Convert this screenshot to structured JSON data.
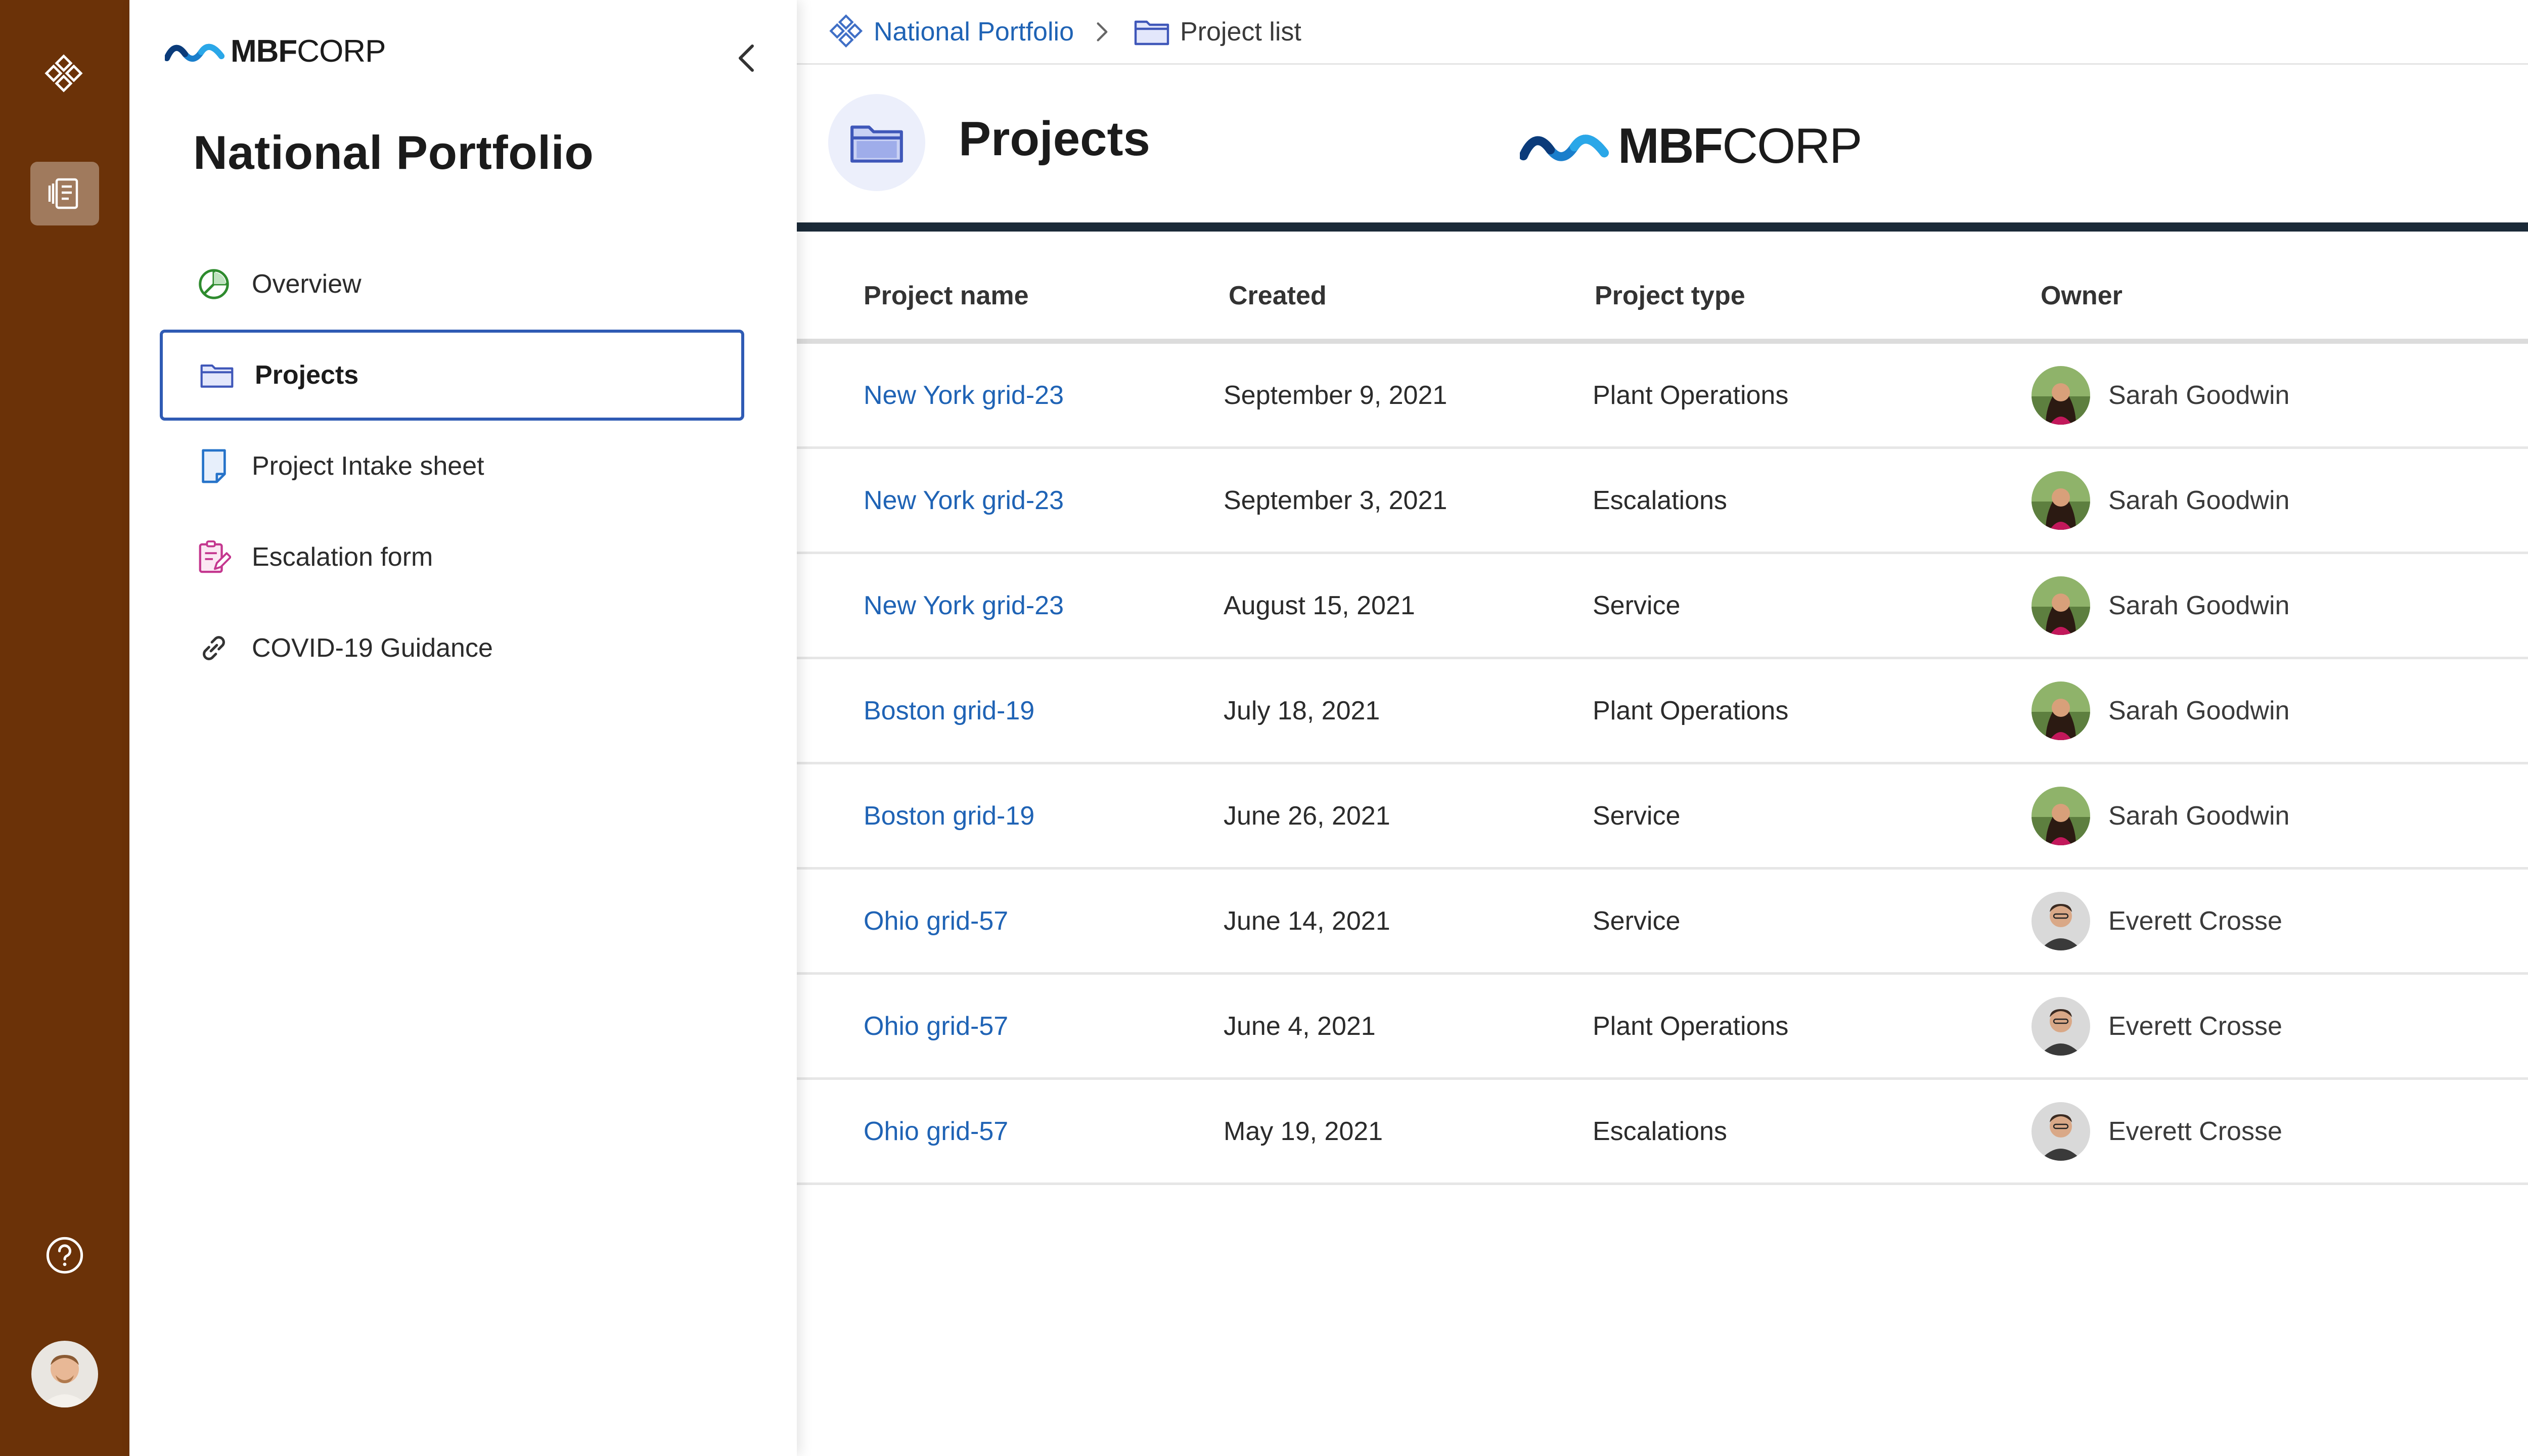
{
  "rail": {
    "items": [
      {
        "name": "apps-icon"
      },
      {
        "name": "portfolio-icon",
        "active": true
      }
    ],
    "help_icon": "help-circle-icon",
    "user_avatar": "user-avatar"
  },
  "leftnav": {
    "brand": {
      "bold": "MBF",
      "light": "CORP"
    },
    "site_title": "National Portfolio",
    "items": [
      {
        "label": "Overview",
        "icon": "pie-chart-icon"
      },
      {
        "label": "Projects",
        "icon": "folder-icon",
        "selected": true
      },
      {
        "label": "Project Intake sheet",
        "icon": "document-icon"
      },
      {
        "label": "Escalation form",
        "icon": "form-edit-icon"
      },
      {
        "label": "COVID-19 Guidance",
        "icon": "link-icon"
      }
    ]
  },
  "breadcrumb": {
    "root": "National Portfolio",
    "current": "Project list"
  },
  "header": {
    "title": "Projects",
    "logo": {
      "bold": "MBF",
      "light": "CORP"
    }
  },
  "table": {
    "columns": [
      "Project name",
      "Created",
      "Project type",
      "Owner"
    ],
    "rows": [
      {
        "name": "New York grid-23",
        "created": "September 9, 2021",
        "type": "Plant Operations",
        "owner": "Sarah Goodwin"
      },
      {
        "name": "New York grid-23",
        "created": "September 3, 2021",
        "type": "Escalations",
        "owner": "Sarah Goodwin"
      },
      {
        "name": "New York grid-23",
        "created": "August 15, 2021",
        "type": "Service",
        "owner": "Sarah Goodwin"
      },
      {
        "name": "Boston grid-19",
        "created": "July 18, 2021",
        "type": "Plant Operations",
        "owner": "Sarah Goodwin"
      },
      {
        "name": "Boston grid-19",
        "created": "June 26, 2021",
        "type": "Service",
        "owner": "Sarah Goodwin"
      },
      {
        "name": "Ohio grid-57",
        "created": "June 14, 2021",
        "type": "Service",
        "owner": "Everett Crosse"
      },
      {
        "name": "Ohio grid-57",
        "created": "June 4, 2021",
        "type": "Plant Operations",
        "owner": "Everett Crosse"
      },
      {
        "name": "Ohio grid-57",
        "created": "May 19, 2021",
        "type": "Escalations",
        "owner": "Everett Crosse"
      }
    ]
  },
  "colors": {
    "rail": "#6b3208",
    "link": "#1f63b5",
    "selected_border": "#2f5bb4",
    "header_rule": "#1b2a38"
  }
}
